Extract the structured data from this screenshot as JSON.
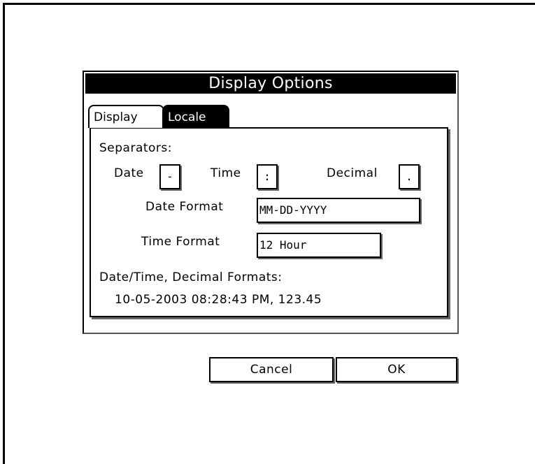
{
  "dialog": {
    "title": "Display Options",
    "tabs": [
      {
        "label": "Display",
        "selected": false
      },
      {
        "label": "Locale",
        "selected": true
      }
    ],
    "separators_label": "Separators:",
    "date_label": "Date",
    "date_value": "-",
    "time_label": "Time",
    "time_value": ":",
    "decimal_label": "Decimal",
    "decimal_value": ".",
    "date_format_label": "Date Format",
    "date_format_value": "MM-DD-YYYY",
    "time_format_label": "Time Format",
    "time_format_value": "12 Hour",
    "preview_label": "Date/Time, Decimal Formats:",
    "preview_value": "10-05-2003 08:28:43 PM,  123.45"
  },
  "buttons": {
    "cancel": "Cancel",
    "ok": "OK"
  },
  "colors": {
    "title_bar": "#000000",
    "selected_tab": "#000000",
    "background": "#ffffff"
  }
}
